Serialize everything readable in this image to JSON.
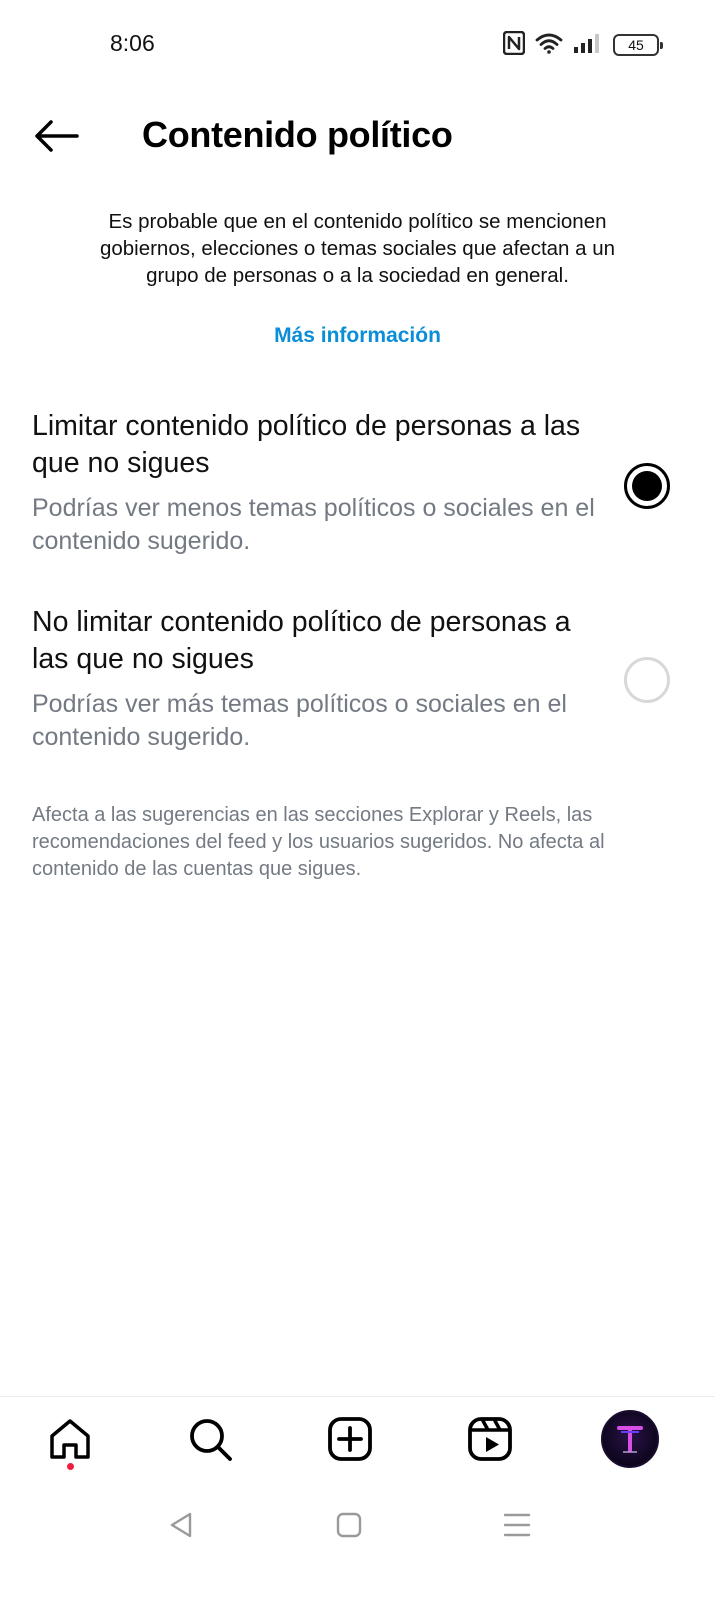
{
  "status_bar": {
    "time": "8:06",
    "battery": "45",
    "icons": [
      "nfc-icon",
      "wifi-icon",
      "cell-signal-icon",
      "battery-icon"
    ]
  },
  "header": {
    "title": "Contenido político",
    "back_icon": "arrow-left-icon"
  },
  "intro": {
    "text": "Es probable que en el contenido político se mencionen gobiernos, elecciones o temas sociales que afectan a un grupo de personas o a la sociedad en general.",
    "link": "Más información",
    "link_color": "#0a8ed8"
  },
  "options": [
    {
      "title": "Limitar contenido político de personas a las que no sigues",
      "description": "Podrías ver menos temas políticos o sociales en el contenido sugerido.",
      "selected": true
    },
    {
      "title": "No limitar contenido político de personas a las que no sigues",
      "description": "Podrías ver más temas políticos o sociales en el contenido sugerido.",
      "selected": false
    }
  ],
  "note": "Afecta a las sugerencias en las secciones Explorar y Reels, las recomendaciones del feed y los usuarios sugeridos. No afecta al contenido de las cuentas que sigues.",
  "bottom_nav": {
    "items": [
      "home-icon",
      "search-icon",
      "create-icon",
      "reels-icon",
      "profile-avatar"
    ],
    "notification_dot_color": "#ee1d3d"
  },
  "system_nav": {
    "items": [
      "back-triangle-icon",
      "home-square-icon",
      "recents-menu-icon"
    ]
  }
}
